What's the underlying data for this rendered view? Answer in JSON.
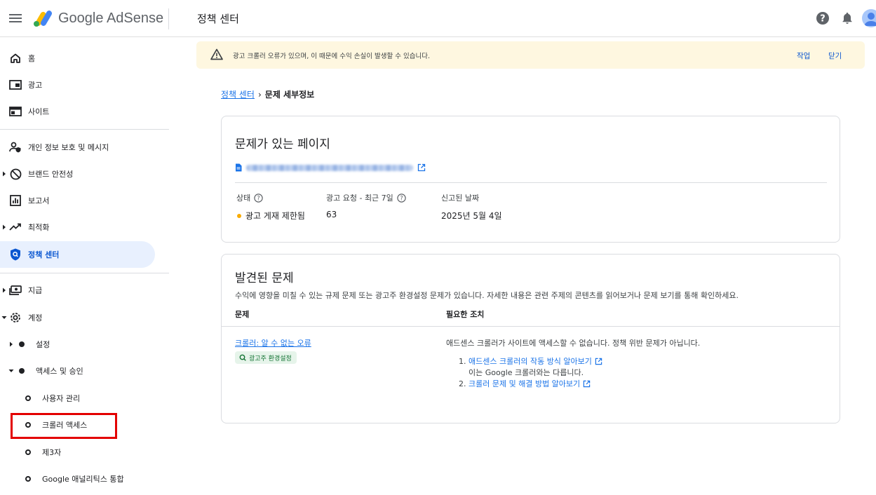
{
  "header": {
    "brand": "Google AdSense",
    "page_title": "정책 센터"
  },
  "sidebar": {
    "items": [
      {
        "label": "홈",
        "icon": "home-icon"
      },
      {
        "label": "광고",
        "icon": "ads-icon"
      },
      {
        "label": "사이트",
        "icon": "sites-icon"
      },
      {
        "label": "개인 정보 보호 및 메시지",
        "icon": "privacy-icon"
      },
      {
        "label": "브랜드 안전성",
        "icon": "block-icon"
      },
      {
        "label": "보고서",
        "icon": "reports-icon"
      },
      {
        "label": "최적화",
        "icon": "trending-icon"
      },
      {
        "label": "정책 센터",
        "icon": "policy-shield-icon"
      },
      {
        "label": "지급",
        "icon": "payments-icon"
      },
      {
        "label": "계정",
        "icon": "gear-icon"
      }
    ],
    "account_sub": {
      "settings": "설정",
      "access": "액세스 및 승인",
      "access_children": [
        "사용자 관리",
        "크롤러 액세스",
        "제3자",
        "Google 애널리틱스 통합"
      ]
    }
  },
  "banner": {
    "message": "광고 크롤러 오류가 있으며, 이 때문에 수익 손실이 발생할 수 있습니다.",
    "action_label": "작업",
    "dismiss_label": "닫기"
  },
  "breadcrumb": {
    "root": "정책 센터",
    "separator": "›",
    "current": "문제 세부정보"
  },
  "page_card": {
    "title": "문제가 있는 페이지",
    "status_label": "상태",
    "requests_label": "광고 요청 - 최근 7일",
    "reported_label": "신고된 날짜",
    "status_value": "광고 게재 제한됨",
    "requests_value": "63",
    "reported_value": "2025년 5월 4일"
  },
  "issues_card": {
    "title": "발견된 문제",
    "description": "수익에 영향을 미칠 수 있는 규제 문제 또는 광고주 환경설정 문제가 있습니다. 자세한 내용은 관련 주제의 콘텐츠를 읽어보거나 문제 보기를 통해 확인하세요.",
    "col_issue": "문제",
    "col_action": "필요한 조치",
    "issue_link": "크롤러: 알 수 없는 오류",
    "issue_chip": "광고주 환경설정",
    "action_text": "애드센스 크롤러가 사이트에 액세스할 수 없습니다. 정책 위반 문제가 아닙니다.",
    "steps": [
      {
        "num": "1.",
        "link": "애드센스 크롤러의 작동 방식 알아보기",
        "note": "이는 Google 크롤러와는 다릅니다."
      },
      {
        "num": "2.",
        "link": "크롤러 문제 및 해결 방법 알아보기"
      }
    ]
  },
  "colors": {
    "accent": "#0b57d0",
    "link": "#1a73e8",
    "banner_bg": "#fef7e0",
    "active_nav_bg": "#e8f0fe",
    "status_dot": "#f9ab00",
    "highlight": "#e30000"
  }
}
